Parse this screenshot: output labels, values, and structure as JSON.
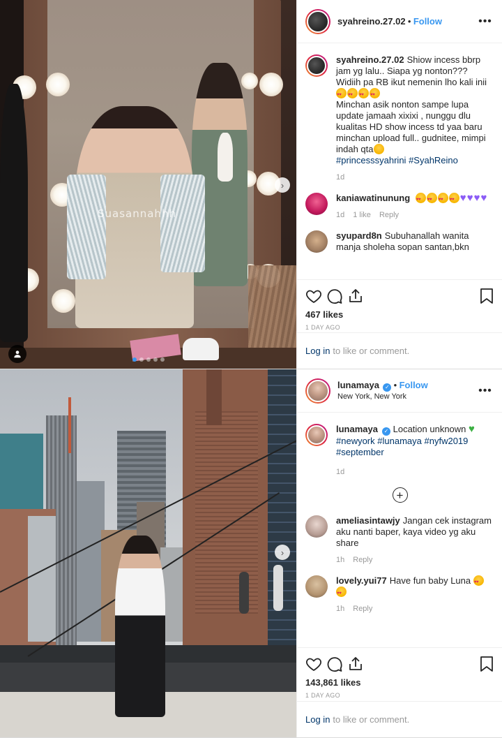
{
  "posts": [
    {
      "username": "syahreino.27.02",
      "follow_label": "Follow",
      "separator": "•",
      "more_label": "•••",
      "caption": {
        "username": "syahreino.27.02",
        "text": "Shiow incess bbrp jam yg lalu.. Siapa yg nonton??? Widiih pa RB ikut nemenin lho kali inii",
        "text2": "Minchan asik nonton sampe lupa update jamaah xixixi , nunggu dlu kualitas HD show incess td yaa baru minchan upload full.. gudnitee, mimpi indah qta",
        "hashtags": [
          "#princesssyahrini",
          "#SyahReino"
        ],
        "time": "1d"
      },
      "media_watermark": "Suasannahhh",
      "comments": [
        {
          "username": "kaniawatinunung",
          "text": "",
          "time": "1d",
          "likes": "1 like",
          "reply": "Reply"
        },
        {
          "username": "syupard8n",
          "text": "Subuhanallah wanita manja sholeha sopan santan,bkn",
          "time": "",
          "likes": "",
          "reply": ""
        }
      ],
      "likes": "467 likes",
      "timestamp": "1 DAY AGO",
      "login_link": "Log in",
      "login_text": "to like or comment."
    },
    {
      "username": "lunamaya",
      "follow_label": "Follow",
      "separator": "•",
      "location": "New York, New York",
      "more_label": "•••",
      "caption": {
        "username": "lunamaya",
        "text": "Location unknown",
        "hashtags": [
          "#newyork",
          "#lunamaya",
          "#nyfw2019",
          "#september"
        ],
        "time": "1d"
      },
      "load_more_label": "+",
      "comments": [
        {
          "username": "ameliasintawjy",
          "text": "Jangan cek instagram aku nanti baper, kaya video yg aku share",
          "time": "1h",
          "reply": "Reply"
        },
        {
          "username": "lovely.yui77",
          "text": "Have fun baby Luna",
          "time": "1h",
          "reply": "Reply"
        }
      ],
      "likes": "143,861 likes",
      "timestamp": "1 DAY AGO",
      "login_link": "Log in",
      "login_text": "to like or comment."
    }
  ],
  "colors": {
    "accent": "#3897f0",
    "hashtag": "#003569",
    "muted": "#999999",
    "text": "#262626"
  },
  "icons": [
    "heart-icon",
    "comment-icon",
    "share-icon",
    "bookmark-icon",
    "more-icon",
    "user-tag-icon",
    "chevron-right-icon",
    "verified-icon",
    "plus-circle-icon"
  ]
}
